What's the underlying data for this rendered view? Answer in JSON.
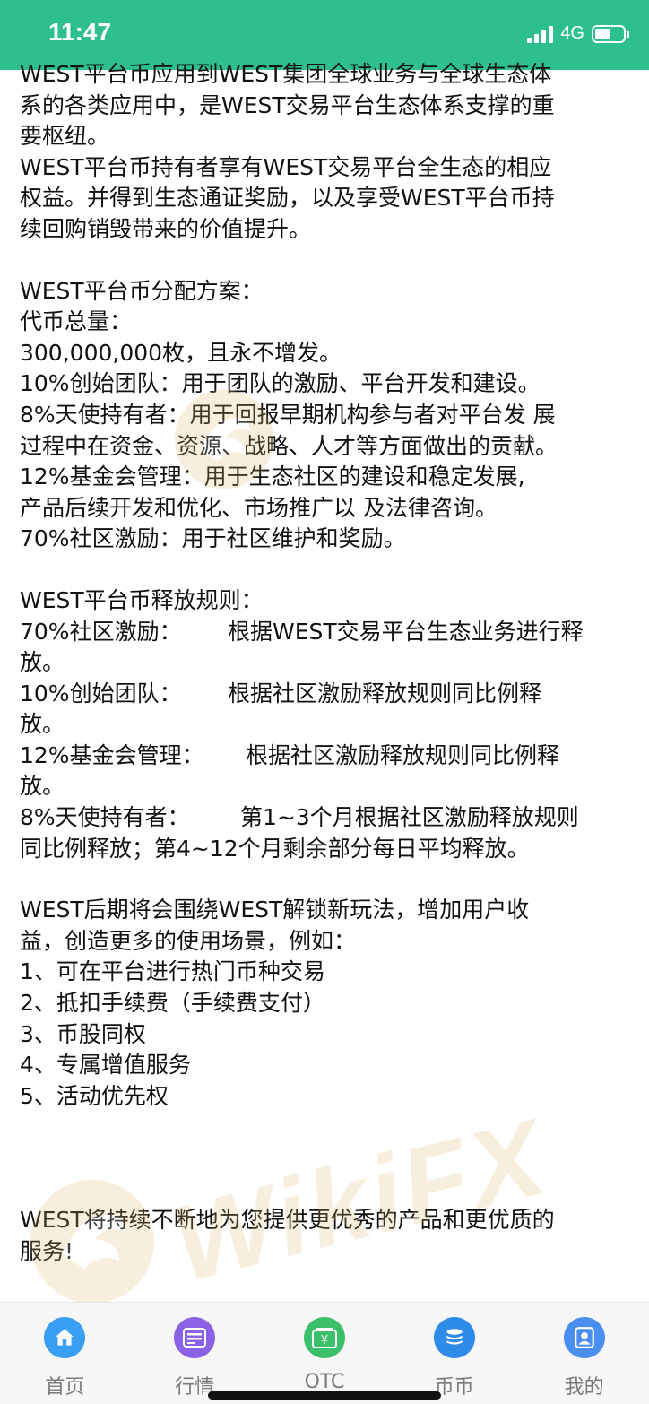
{
  "status_bar": {
    "time": "11:47",
    "network": "4G",
    "battery_level": 0.55
  },
  "content": {
    "intro": [
      "WEST平台币应用到WEST集团全球业务与全球生态体",
      "系的各类应用中，是WEST交易平台生态体系支撑的重",
      "要枢纽。",
      "WEST平台币持有者享有WEST交易平台全生态的相应",
      "权益。并得到生态通证奖励，以及享受WEST平台币持",
      "续回购销毁带来的价值提升。"
    ],
    "allocation": [
      "WEST平台币分配方案：",
      "代币总量：",
      "300,000,000枚，且永不增发。",
      "10%创始团队：用于团队的激励、平台开发和建设。",
      "8%天使持有者：用于回报早期机构参与者对平台发 展",
      "过程中在资金、资源、战略、人才等方面做出的贡献。",
      "12%基金会管理：用于生态社区的建设和稳定发展,",
      "产品后续开发和优化、市场推广以 及法律咨询。",
      "70%社区激励：用于社区维护和奖励。"
    ],
    "release": {
      "title": "WEST平台币释放规则：",
      "rows": [
        {
          "label": "70%社区激励：",
          "text": "根据WEST交易平台生态业务进行释",
          "cont": "放。"
        },
        {
          "label": "10%创始团队：",
          "text": "根据社区激励释放规则同比例释",
          "cont": "放。"
        },
        {
          "label": "12%基金会管理：",
          "text": "根据社区激励释放规则同比例释",
          "cont": "放。"
        },
        {
          "label": "8%天使持有者：",
          "text": "第1~3个月根据社区激励释放规则",
          "cont": "同比例释放；第4~12个月剩余部分每日平均释放。"
        }
      ]
    },
    "future": [
      "WEST后期将会围绕WEST解锁新玩法，增加用户收",
      "益，创造更多的使用场景，例如：",
      "1、可在平台进行热门币种交易",
      "2、抵扣手续费（手续费支付）",
      "3、币股同权",
      "4、专属增值服务",
      "5、活动优先权"
    ],
    "closing": [
      "WEST将持续不断地为您提供更优秀的产品和更优质的",
      "服务!"
    ]
  },
  "watermark": {
    "text": "WikiFX"
  },
  "tab_bar": {
    "tabs": [
      {
        "label": "首页",
        "icon": "home-icon",
        "color": "#3a9ef5"
      },
      {
        "label": "行情",
        "icon": "chart-card-icon",
        "color": "#8b62e6"
      },
      {
        "label": "OTC",
        "icon": "wallet-icon",
        "color": "#3cbf6a",
        "glyph": "¥"
      },
      {
        "label": "币币",
        "icon": "coin-stack-icon",
        "color": "#2f8be8"
      },
      {
        "label": "我的",
        "icon": "user-icon",
        "color": "#4a8ff0"
      }
    ]
  }
}
